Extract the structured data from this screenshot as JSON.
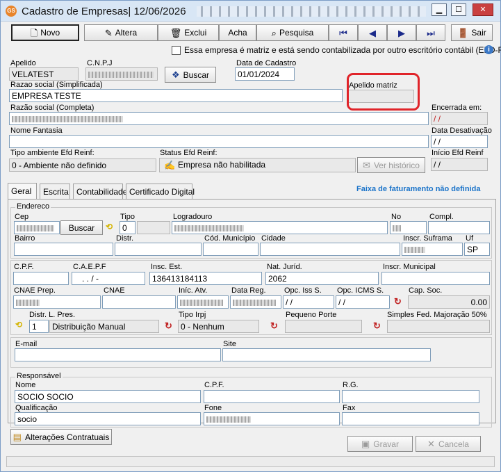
{
  "window": {
    "app_icon_text": "GS",
    "title": "Cadastro de Empresas|  12/06/2026",
    "min_glyph": "▁",
    "max_glyph": "☐",
    "close_glyph": "✕"
  },
  "toolbar": {
    "novo": "Novo",
    "altera": "Altera",
    "exclui": "Exclui",
    "acha": "Acha",
    "pesquisa": "Pesquisa",
    "sair": "Sair",
    "first_glyph": "⏮",
    "prev_glyph": "◀",
    "next_glyph": "▶",
    "last_glyph": "⏭"
  },
  "matrix_checkbox": {
    "label": "Essa empresa é matriz e está sendo contabilizada por outro escritório contábil (EFD-Reinf",
    "checked": false,
    "info_glyph": "i"
  },
  "header_fields": {
    "apelido_label": "Apelido",
    "apelido_value": "VELATEST",
    "cnpj_label": "C.N.P.J",
    "buscar_label": "Buscar",
    "data_cadastro_label": "Data de Cadastro",
    "data_cadastro_value": "01/01/2024",
    "razao_simpl_label": "Razao social (Simplificada)",
    "razao_simpl_value": "EMPRESA TESTE",
    "apelido_matriz_label": "Apelido matriz",
    "apelido_matriz_value": "",
    "razao_completa_label": "Razão social (Completa)",
    "encerrada_label": "Encerrada em:",
    "encerrada_value": " / /",
    "nome_fantasia_label": "Nome Fantasia",
    "nome_fantasia_value": "",
    "data_desativacao_label": "Data Desativação",
    "data_desativacao_value": " / /",
    "tipo_ambiente_label": "Tipo ambiente Efd Reinf:",
    "tipo_ambiente_value": "0 - Ambiente não definido",
    "status_efd_label": "Status Efd Reinf:",
    "status_efd_value": "Empresa não habilitada",
    "ver_historico_label": "Ver histórico",
    "inicio_efd_label": "Início Efd Reinf",
    "inicio_efd_value": " / /"
  },
  "tabs": [
    {
      "label": "Geral"
    },
    {
      "label": "Escrita"
    },
    {
      "label": "Contabilidade"
    },
    {
      "label": "Certificado Digital"
    }
  ],
  "faixa_faturamento": "Faixa de faturamento não definida",
  "endereco": {
    "legend": "Endereco",
    "cep_label": "Cep",
    "buscar_label": "Buscar",
    "tipo_label": "Tipo",
    "tipo_value": "0",
    "logradouro_label": "Logradouro",
    "no_label": "No",
    "compl_label": "Compl.",
    "bairro_label": "Bairro",
    "distr_label": "Distr.",
    "cod_municipio_label": "Cód. Município",
    "cidade_label": "Cidade",
    "inscr_suframa_label": "Inscr. Suframa",
    "uf_label": "Uf",
    "uf_value": "SP"
  },
  "fiscal": {
    "cpf_label": "C.P.F.",
    "caepf_label": "C.A.E.P.F",
    "caepf_value": ". . / -",
    "insc_est_label": "Insc. Est.",
    "insc_est_value": "136413184113",
    "nat_jurid_label": "Nat. Juríd.",
    "nat_jurid_value": "2062",
    "inscr_municipal_label": "Inscr. Municipal",
    "cnae_prep_label": "CNAE Prep.",
    "cnae_label": "CNAE",
    "inic_atv_label": "Iníc. Atv.",
    "data_reg_label": "Data Reg.",
    "opc_iss_label": "Opc. Iss S.",
    "opc_iss_value": " / /",
    "opc_icms_label": "Opc. ICMS S.",
    "opc_icms_value": " / /",
    "cap_soc_label": "Cap. Soc.",
    "cap_soc_value": "0.00",
    "distr_l_pres_label": "Distr. L. Pres.",
    "distr_l_pres_code": "1",
    "distr_l_pres_value": "Distribuição Manual",
    "tipo_irpj_label": "Tipo Irpj",
    "tipo_irpj_value": "0 - Nenhum",
    "pequeno_porte_label": "Pequeno Porte",
    "simples_label": "Simples Fed. Majoração 50%"
  },
  "contato": {
    "email_label": "E-mail",
    "site_label": "Site"
  },
  "responsavel": {
    "legend": "Responsável",
    "nome_label": "Nome",
    "nome_value": "SOCIO SOCIO",
    "cpf_label": "C.P.F.",
    "rg_label": "R.G.",
    "qualificacao_label": "Qualificação",
    "qualificacao_value": "socio",
    "fone_label": "Fone",
    "fax_label": "Fax"
  },
  "footer": {
    "alteracoes_label": "Alterações Contratuais",
    "gravar_label": "Gravar",
    "cancela_label": "Cancela"
  },
  "colors": {
    "highlight_oval": "#e0242a",
    "faixa_text": "#1a73c9",
    "titlebar": "#d8e6f5"
  }
}
